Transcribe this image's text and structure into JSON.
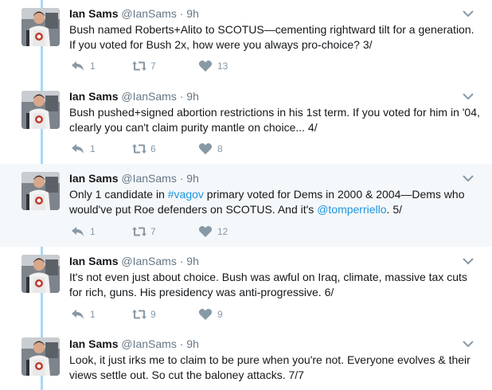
{
  "tweets": [
    {
      "name": "Ian Sams",
      "handle": "@IanSams",
      "dot": "·",
      "time": "9h",
      "text_parts": [
        {
          "t": "Bush named Roberts+Alito to SCOTUS—cementing rightward tilt for a generation. If you voted for Bush 2x, how were you always pro-choice? 3/"
        }
      ],
      "replies": "1",
      "retweets": "7",
      "likes": "13",
      "highlighted": false
    },
    {
      "name": "Ian Sams",
      "handle": "@IanSams",
      "dot": "·",
      "time": "9h",
      "text_parts": [
        {
          "t": "Bush pushed+signed abortion restrictions in his 1st term. If you voted for him in '04, clearly you can't claim purity mantle on choice... 4/"
        }
      ],
      "replies": "1",
      "retweets": "6",
      "likes": "8",
      "highlighted": false
    },
    {
      "name": "Ian Sams",
      "handle": "@IanSams",
      "dot": "·",
      "time": "9h",
      "text_parts": [
        {
          "t": "Only 1 candidate in "
        },
        {
          "t": "#vagov",
          "link": true
        },
        {
          "t": " primary voted for Dems in 2000 & 2004—Dems who would've put Roe defenders on SCOTUS. And it's "
        },
        {
          "t": "@tomperriello",
          "link": true
        },
        {
          "t": ". 5/"
        }
      ],
      "replies": "1",
      "retweets": "7",
      "likes": "12",
      "highlighted": true
    },
    {
      "name": "Ian Sams",
      "handle": "@IanSams",
      "dot": "·",
      "time": "9h",
      "text_parts": [
        {
          "t": "It's not even just about choice. Bush was awful on Iraq, climate, massive tax cuts for rich, guns. His presidency was anti-progressive. 6/"
        }
      ],
      "replies": "1",
      "retweets": "9",
      "likes": "9",
      "highlighted": false
    },
    {
      "name": "Ian Sams",
      "handle": "@IanSams",
      "dot": "·",
      "time": "9h",
      "text_parts": [
        {
          "t": "Look, it just irks me to claim to be pure when you're not. Everyone evolves & their views settle out. So cut the baloney attacks. 7/7"
        }
      ],
      "replies": "",
      "retweets": "",
      "likes": "",
      "highlighted": false
    }
  ],
  "colors": {
    "link": "#1b95e0",
    "thread_line": "#aad8f2",
    "highlight_bg": "#f5f8fa",
    "action_gray": "#8899a6"
  },
  "icons": [
    "reply-icon",
    "retweet-icon",
    "heart-icon",
    "chevron-down-icon"
  ]
}
